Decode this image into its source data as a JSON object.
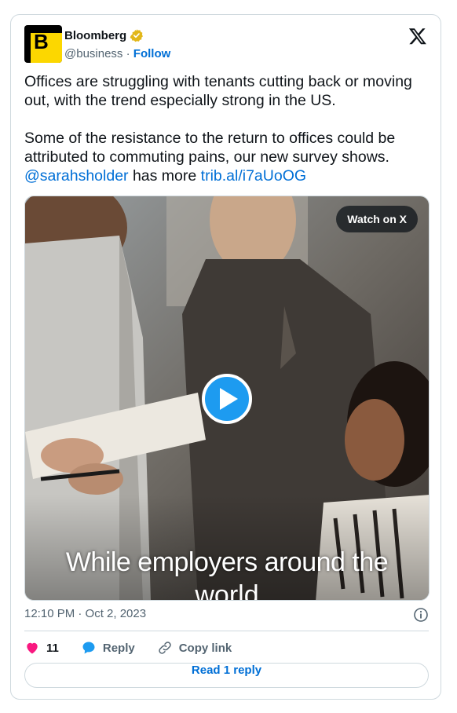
{
  "author": {
    "logo_letter": "B",
    "name": "Bloomberg",
    "handle": "@business",
    "separator": "·",
    "follow_label": "Follow"
  },
  "tweet": {
    "paragraph1": "Offices are struggling with tenants cutting back or moving out, with the trend especially strong in the US.",
    "paragraph2_text": "Some of the resistance to the return to offices could be attributed to commuting pains, our new survey shows.",
    "mention": "@sarahsholder",
    "middle_text": " has more ",
    "link": "trib.al/i7aUoOG"
  },
  "media": {
    "watch_label": "Watch on X",
    "caption_line1": "While employers around the",
    "caption_line2": "world"
  },
  "meta": {
    "timestamp": "12:10 PM · Oct 2, 2023"
  },
  "actions": {
    "likes_count": "11",
    "reply_label": "Reply",
    "copy_link_label": "Copy link"
  },
  "read_reply_label": "Read 1 reply",
  "colors": {
    "link": "#006fd6",
    "like": "#f91880",
    "reply": "#1d9bf0",
    "logo_yellow": "#fcd700"
  }
}
